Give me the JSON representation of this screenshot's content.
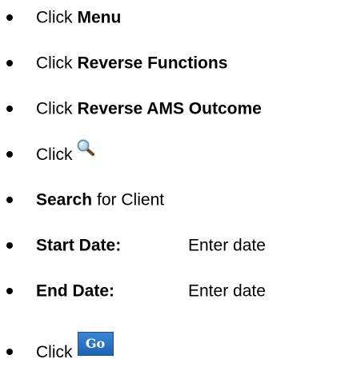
{
  "steps": [
    {
      "prefix": "Click",
      "bold": "Menu"
    },
    {
      "prefix": "Click",
      "bold": "Reverse Functions"
    },
    {
      "prefix": "Click",
      "bold": "Reverse AMS Outcome"
    },
    {
      "prefix": "Click",
      "icon": "search-icon"
    },
    {
      "bold": "Search",
      "suffix": "for Client"
    },
    {
      "bold": "Start Date:",
      "value": "Enter date"
    },
    {
      "bold": "End Date:",
      "value": "Enter date"
    },
    {
      "prefix": "Click",
      "button": "Go"
    }
  ],
  "colors": {
    "go_button_bg": "#2a74c8",
    "go_button_text": "#ffffff"
  }
}
